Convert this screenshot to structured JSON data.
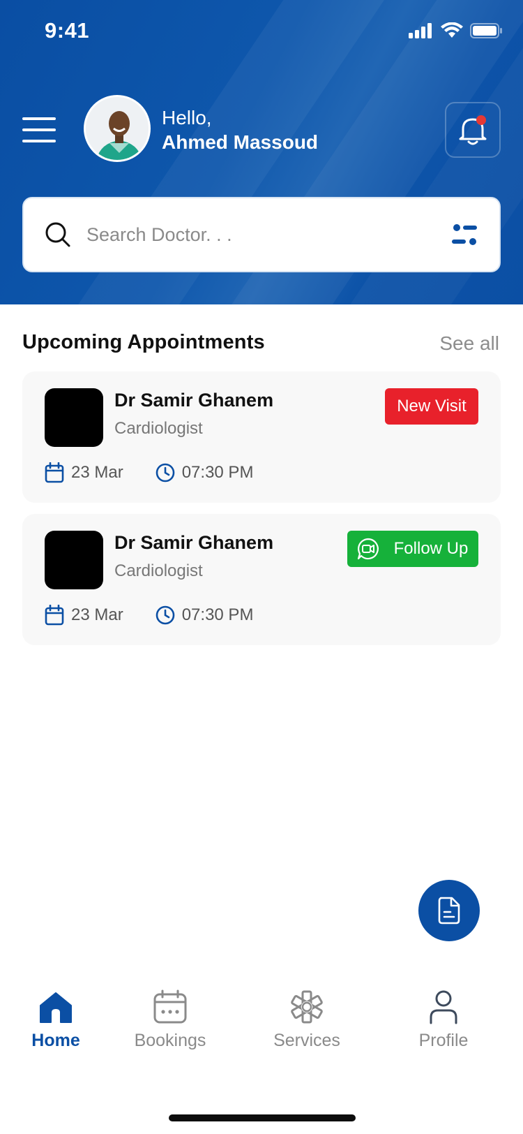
{
  "status_bar": {
    "time": "9:41"
  },
  "header": {
    "greeting": "Hello,",
    "user_name": "Ahmed Massoud"
  },
  "search": {
    "placeholder": "Search Doctor. . ."
  },
  "appointments": {
    "title": "Upcoming Appointments",
    "see_all": "See all",
    "items": [
      {
        "doctor": "Dr Samir Ghanem",
        "specialty": "Cardiologist",
        "date": "23 Mar",
        "time": "07:30 PM",
        "badge": "New Visit",
        "badge_color": "#e8212b"
      },
      {
        "doctor": "Dr Samir Ghanem",
        "specialty": "Cardiologist",
        "date": "23 Mar",
        "time": "07:30 PM",
        "badge": "Follow Up",
        "badge_color": "#16b13a"
      }
    ]
  },
  "tabs": [
    {
      "label": "Home",
      "icon": "home-icon",
      "active": true
    },
    {
      "label": "Bookings",
      "icon": "calendar-icon",
      "active": false
    },
    {
      "label": "Services",
      "icon": "medical-star-icon",
      "active": false
    },
    {
      "label": "Profile",
      "icon": "user-icon",
      "active": false
    }
  ],
  "colors": {
    "primary": "#0b4fa4",
    "notification_dot": "#e53935",
    "new_visit": "#e8212b",
    "follow_up": "#16b13a"
  }
}
